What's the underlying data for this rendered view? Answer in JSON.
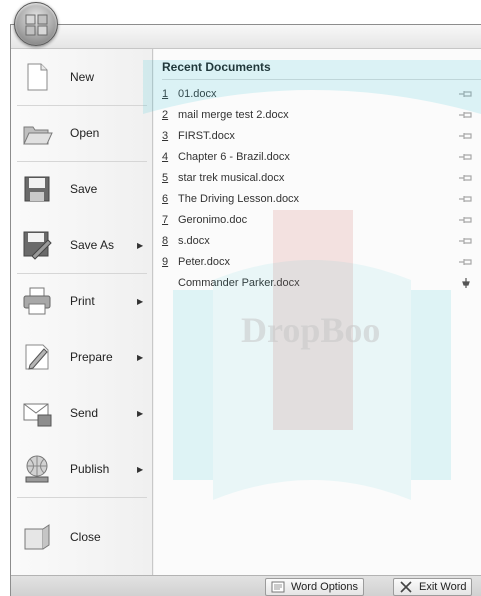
{
  "menu": {
    "commands": [
      {
        "label": "New",
        "underline": "N",
        "has_submenu": false,
        "icon": "new-document-icon"
      },
      {
        "label": "Open",
        "underline": "O",
        "has_submenu": false,
        "icon": "open-folder-icon"
      },
      {
        "label": "Save",
        "underline": "S",
        "has_submenu": false,
        "icon": "save-disk-icon"
      },
      {
        "label": "Save As",
        "underline": "A",
        "has_submenu": true,
        "icon": "save-as-icon"
      },
      {
        "label": "Print",
        "underline": "P",
        "has_submenu": true,
        "icon": "printer-icon"
      },
      {
        "label": "Prepare",
        "underline": "e",
        "has_submenu": true,
        "icon": "prepare-icon"
      },
      {
        "label": "Send",
        "underline": "d",
        "has_submenu": true,
        "icon": "send-icon"
      },
      {
        "label": "Publish",
        "underline": "u",
        "has_submenu": true,
        "icon": "publish-icon"
      },
      {
        "label": "Close",
        "underline": "C",
        "has_submenu": false,
        "icon": "close-document-icon"
      }
    ],
    "submenu_arrow": "▶"
  },
  "recent": {
    "title": "Recent Documents",
    "items": [
      {
        "num": "1",
        "name": "01.docx",
        "pinned": false
      },
      {
        "num": "2",
        "name": "mail merge test 2.docx",
        "pinned": false
      },
      {
        "num": "3",
        "name": "FIRST.docx",
        "pinned": false
      },
      {
        "num": "4",
        "name": "Chapter 6 - Brazil.docx",
        "pinned": false
      },
      {
        "num": "5",
        "name": "star trek musical.docx",
        "pinned": false
      },
      {
        "num": "6",
        "name": "The Driving Lesson.docx",
        "pinned": false
      },
      {
        "num": "7",
        "name": "Geronimo.doc",
        "pinned": false
      },
      {
        "num": "8",
        "name": "s.docx",
        "pinned": false
      },
      {
        "num": "9",
        "name": "Peter.docx",
        "pinned": false
      },
      {
        "num": "",
        "name": "Commander Parker.docx",
        "pinned": true
      }
    ]
  },
  "bottom": {
    "word_options": "Word Options",
    "exit_word": "Exit Word"
  },
  "watermark": {
    "text": "DropBoo"
  },
  "colors": {
    "watermark_teal": "#35c4d8",
    "watermark_red": "#c0392b"
  }
}
